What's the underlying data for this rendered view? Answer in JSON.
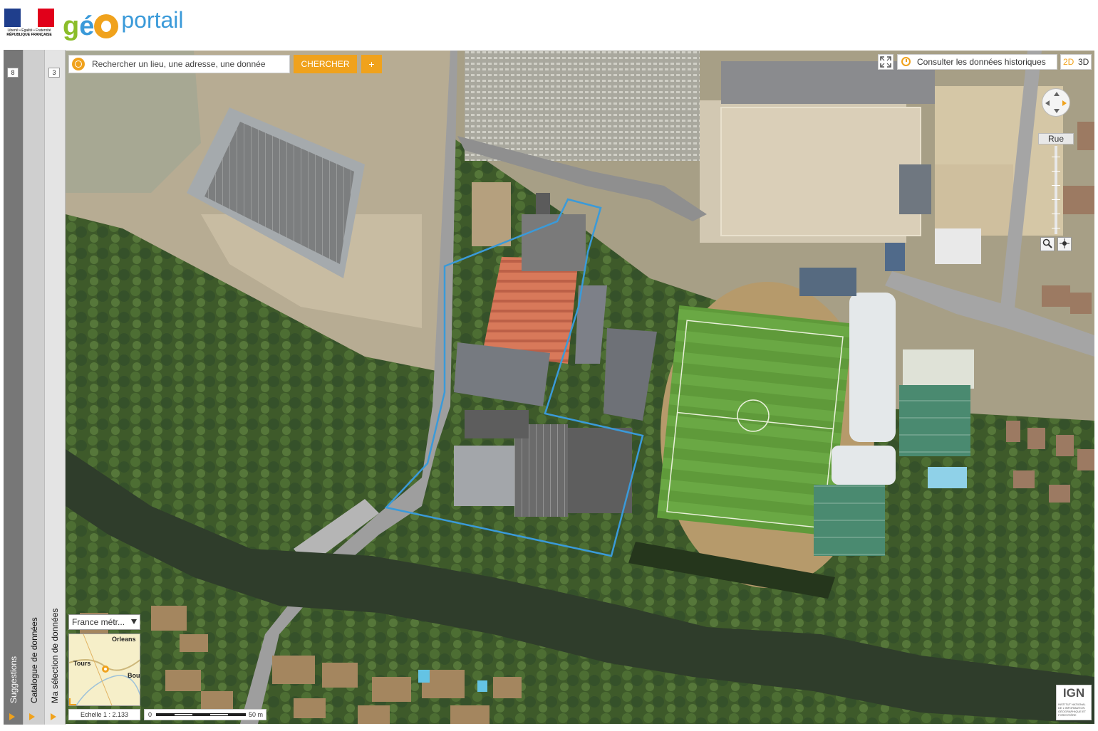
{
  "header": {
    "republic_logo": {
      "line1": "Liberté • Égalité • Fraternité",
      "line2": "RÉPUBLIQUE FRANÇAISE",
      "colors": [
        "#1f3e8c",
        "#ffffff",
        "#e1001a"
      ]
    },
    "brand": {
      "part1": "gé",
      "part2": "portail",
      "colors": {
        "g": "#8bbd2a",
        "blue": "#3a9ad9",
        "orange": "#f0a21c"
      }
    }
  },
  "sidebar": {
    "tabs": [
      {
        "label": "Suggestions",
        "count": "8",
        "icon": "arrow-right-icon"
      },
      {
        "label": "Catalogue de données",
        "count": "",
        "icon": "arrow-right-icon"
      },
      {
        "label": "Ma sélection de données",
        "count": "3",
        "icon": "arrow-right-icon"
      }
    ]
  },
  "search": {
    "placeholder": "Rechercher un lieu, une adresse, une donnée",
    "value": "",
    "submit_label": "CHERCHER",
    "more_label": "+",
    "icon": "target-icon"
  },
  "toolbar": {
    "fullscreen_icon": "fullscreen-icon",
    "history_label": "Consulter les données historiques",
    "history_icon": "clock-icon",
    "view_2d": "2D",
    "view_3d": "3D",
    "active_view": "2D"
  },
  "navigation": {
    "compass_icon": "compass-icon",
    "zoom_label": "Rue",
    "tools": [
      "magnifier-icon",
      "target-icon"
    ]
  },
  "minimap": {
    "projection": "France métr...",
    "cities": [
      "Orleans",
      "Tours",
      "Bour"
    ]
  },
  "scale": {
    "label": "Echelle 1 :  2.133",
    "bar_start": "0",
    "bar_end": "50 m"
  },
  "ign": {
    "title": "IGN",
    "subtitle": "INSTITUT NATIONAL DE L'INFORMATION GÉOGRAPHIQUE ET FORESTIÈRE"
  },
  "colors": {
    "accent": "#f0a21c",
    "parcel_outline": "#3a9ad9",
    "sidebar_dark": "#777777"
  }
}
